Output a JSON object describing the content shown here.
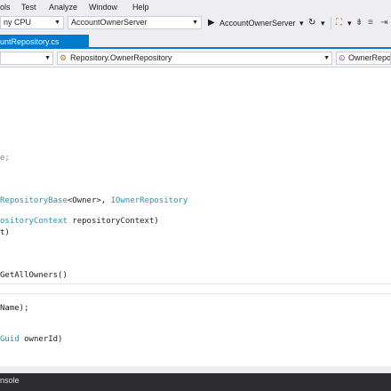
{
  "menu": {
    "items": [
      "ols",
      "Test",
      "Analyze",
      "Window",
      "Help"
    ]
  },
  "toolbar": {
    "platform": "ny CPU",
    "startup_project": "AccountOwnerServer",
    "run_label": "AccountOwnerServer",
    "run_dropdown": "▾"
  },
  "tabs": {
    "active": "untRepository.cs"
  },
  "navigation": {
    "project_combo": "",
    "type_combo": "Repository.OwnerRepository",
    "member_combo": "OwnerRepo"
  },
  "code": {
    "line1": "e;",
    "line2_type1": "RepositoryBase",
    "line2_generic": "<Owner>, ",
    "line2_type2": "IOwnerRepository",
    "line3_type": "ositoryContext",
    "line3_rest": " repositoryContext)",
    "line4": "t)",
    "line5": "GetAllOwners()",
    "line6": "Name);",
    "line7_type": "Guid",
    "line7_rest": " ownerId)"
  },
  "bottom": {
    "console_tab": "nsole"
  }
}
